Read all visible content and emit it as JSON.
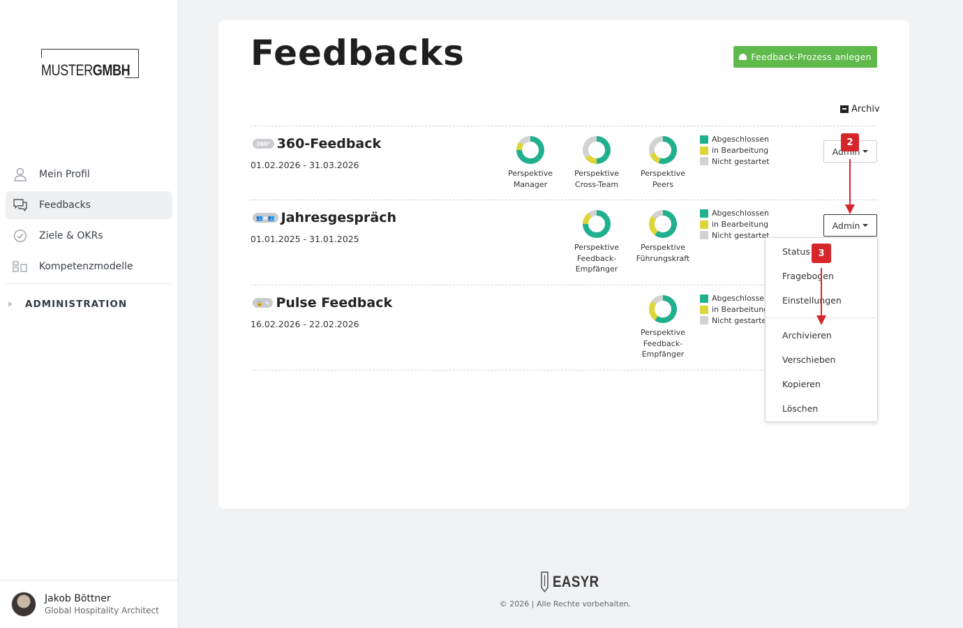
{
  "sidebar": {
    "logo": {
      "part1": "MUSTER",
      "part2": "GMBH"
    },
    "items": [
      {
        "label": "Mein Profil",
        "icon": "user-icon"
      },
      {
        "label": "Feedbacks",
        "icon": "chat-bubbles-icon",
        "active": true
      },
      {
        "label": "Ziele & OKRs",
        "icon": "check-circle-icon"
      },
      {
        "label": "Kompetenzmodelle",
        "icon": "blocks-icon"
      }
    ],
    "admin_label": "ADMINISTRATION",
    "user": {
      "name": "Jakob Böttner",
      "role": "Global Hospitality Architect"
    }
  },
  "main": {
    "title": "Feedbacks",
    "new_button": "Feedback-Prozess anlegen",
    "archive_label": "Archiv",
    "legend": [
      "Abgeschlossen",
      "in Bearbeitung",
      "Nicht gestartet"
    ],
    "admin_label": "Admin",
    "processes": [
      {
        "badge": "360°",
        "title": "360-Feedback",
        "dates": "01.02.2026 - 31.03.2026",
        "perspectives": [
          {
            "line1": "Perspektive",
            "line2": "Manager",
            "line3": "",
            "done": 0.75,
            "progress": 0.1
          },
          {
            "line1": "Perspektive",
            "line2": "Cross-Team",
            "line3": "",
            "done": 0.5,
            "progress": 0.15
          },
          {
            "line1": "Perspektive",
            "line2": "Peers",
            "line3": "",
            "done": 0.55,
            "progress": 0.15
          }
        ]
      },
      {
        "badge": "👥⇄👥",
        "title": "Jahresgespräch",
        "dates": "01.01.2025 - 31.01.2025",
        "perspectives": [
          {
            "line1": "Perspektive",
            "line2": "Feedback-",
            "line3": "Empfänger",
            "done": 0.75,
            "progress": 0.15
          },
          {
            "line1": "Perspektive",
            "line2": "Führungskraft",
            "line3": "",
            "done": 0.6,
            "progress": 0.25
          }
        ]
      },
      {
        "badge": "🔒 ∿",
        "title": "Pulse Feedback",
        "dates": "16.02.2026 - 22.02.2026",
        "perspectives": [
          {
            "line1": "Perspektive",
            "line2": "Feedback-",
            "line3": "Empfänger",
            "done": 0.6,
            "progress": 0.25
          }
        ]
      }
    ],
    "dropdown": [
      "Status",
      "Fragebogen",
      "Einstellungen",
      "Archivieren",
      "Verschieben",
      "Kopieren",
      "Löschen"
    ],
    "annotations": {
      "step2": "2",
      "step3": "3"
    }
  },
  "colors": {
    "done": "#21b08d",
    "progress": "#dcd63a",
    "not_started": "#d2d2d2",
    "accent_green": "#5fba4b",
    "annotation": "#d6252b"
  },
  "footer": {
    "brand": "EASYR",
    "copyright": "© 2026 | Alle Rechte vorbehalten."
  }
}
